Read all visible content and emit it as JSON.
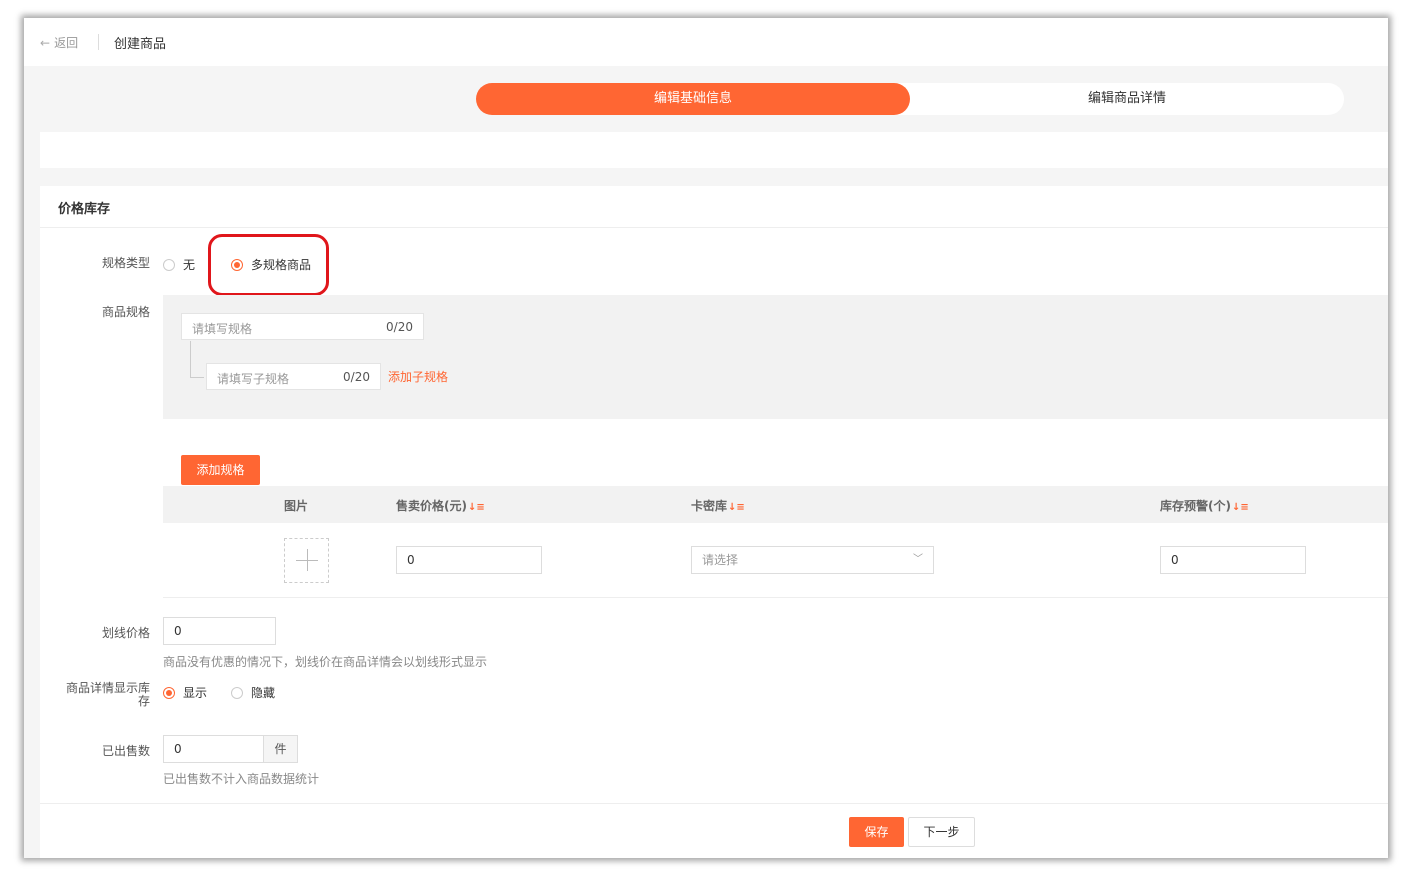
{
  "header": {
    "back_label": "返回",
    "title": "创建商品"
  },
  "steps": [
    {
      "label": "编辑基础信息",
      "active": true
    },
    {
      "label": "编辑商品详情",
      "active": false
    }
  ],
  "section": {
    "title": "价格库存"
  },
  "spec_type": {
    "label": "规格类型",
    "options": [
      {
        "label": "无",
        "checked": false
      },
      {
        "label": "多规格商品",
        "checked": true
      }
    ]
  },
  "product_spec": {
    "label": "商品规格",
    "spec_input": {
      "placeholder": "请填写规格",
      "count": "0/20"
    },
    "sub_spec_input": {
      "placeholder": "请填写子规格",
      "count": "0/20"
    },
    "add_sub_label": "添加子规格",
    "add_spec_button": "添加规格"
  },
  "table": {
    "headers": {
      "image": "图片",
      "price": "售卖价格(元)",
      "card": "卡密库",
      "stock_alert": "库存预警(个)"
    },
    "row": {
      "price": "0",
      "card_placeholder": "请选择",
      "stock_alert": "0"
    }
  },
  "strike_price": {
    "label": "划线价格",
    "value": "0",
    "hint": "商品没有优惠的情况下，划线价在商品详情会以划线形式显示"
  },
  "show_stock": {
    "label_line1": "商品详情显示库",
    "label_line2": "存",
    "options": [
      {
        "label": "显示",
        "checked": true
      },
      {
        "label": "隐藏",
        "checked": false
      }
    ]
  },
  "sold_count": {
    "label": "已出售数",
    "value": "0",
    "unit": "件",
    "hint": "已出售数不计入商品数据统计"
  },
  "footer": {
    "save_label": "保存",
    "next_label": "下一步"
  },
  "colors": {
    "accent": "#ff6633",
    "highlight": "#e0161b"
  }
}
